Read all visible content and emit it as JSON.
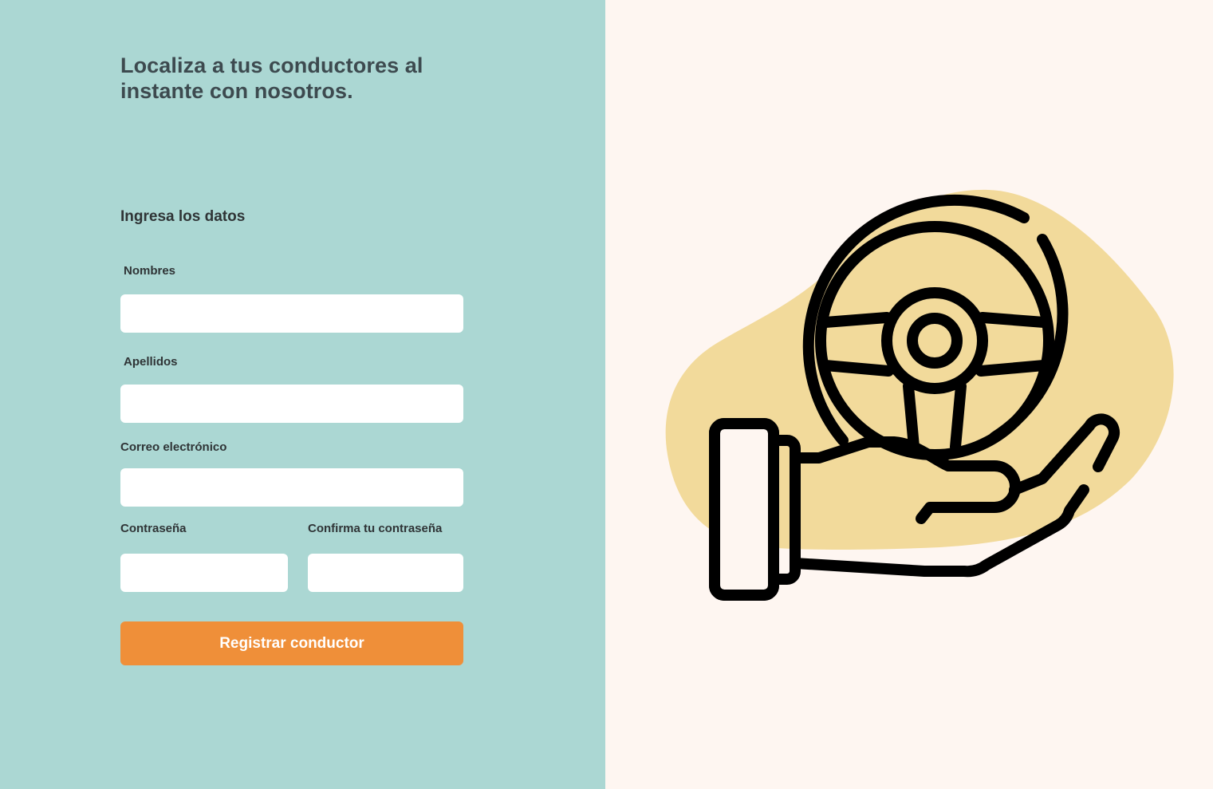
{
  "hero": {
    "headline": "Localiza a tus conductores al instante con nosotros."
  },
  "form": {
    "title": "Ingresa los datos",
    "fields": {
      "nombres": {
        "label": "Nombres",
        "value": "",
        "placeholder": ""
      },
      "apellidos": {
        "label": "Apellidos",
        "value": "",
        "placeholder": ""
      },
      "correo": {
        "label": "Correo electrónico",
        "value": "",
        "placeholder": ""
      },
      "contrasena": {
        "label": "Contraseña",
        "value": "",
        "placeholder": ""
      },
      "confirmar": {
        "label": "Confirma tu contraseña",
        "value": "",
        "placeholder": ""
      }
    },
    "submit_label": "Registrar conductor"
  },
  "illustration": {
    "icon": "steering-wheel-hand-icon",
    "blob_color": "#f2da9b",
    "stroke_color": "#000000"
  },
  "colors": {
    "left_bg": "#abd7d3",
    "right_bg": "#fef6f1",
    "accent": "#ef8f39"
  }
}
